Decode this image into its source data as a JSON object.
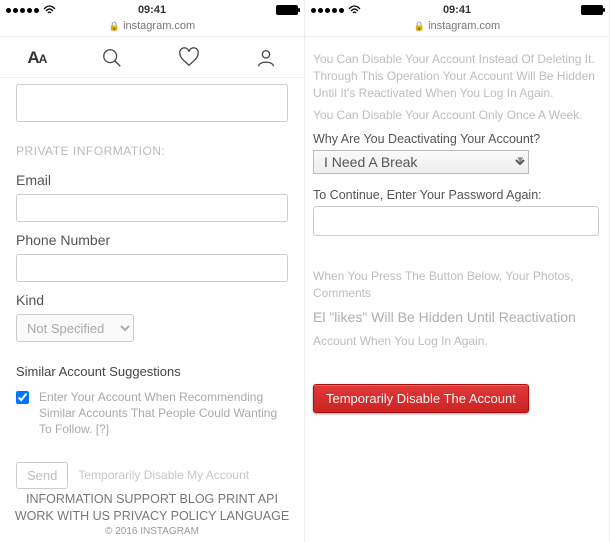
{
  "status": {
    "time": "09:41"
  },
  "address": {
    "host": "instagram.com"
  },
  "left": {
    "tab_aa": "A",
    "section_private": "PRIVATE INFORMATION:",
    "label_email": "Email",
    "label_phone": "Phone Number",
    "label_kind": "Kind",
    "kind_option": "Not Specified",
    "suggestions_title": "Similar Account Suggestions",
    "suggestions_text": "Enter Your Account When Recommending Similar Accounts That People Could Wanting To Follow. [?]",
    "send_btn": "Send",
    "disable_link": "Temporarily Disable My Account",
    "footer_line1": "INFORMATION SUPPORT BLOG PRINT API",
    "footer_line2": "WORK WITH US PRIVACY POLICY LANGUAGE",
    "footer_copy": "© 2016 INSTAGRAM"
  },
  "right": {
    "intro1": "You Can Disable Your Account Instead Of Deleting It. Through This Operation Your Account Will Be Hidden Until It's Reactivated When You Log In Again.",
    "intro2": "You Can Disable Your Account Only Once A Week.",
    "reason_q": "Why Are You Deactivating Your Account?",
    "reason_selected": "I Need A Break",
    "pw_q": "To Continue, Enter Your Password Again:",
    "note_line1": "When You Press The Button Below, Your Photos, Comments",
    "note_line2": "El \"likes\" Will Be Hidden Until Reactivation",
    "note_line3": "Account When You Log In Again.",
    "disable_btn": "Temporarily Disable The Account"
  }
}
